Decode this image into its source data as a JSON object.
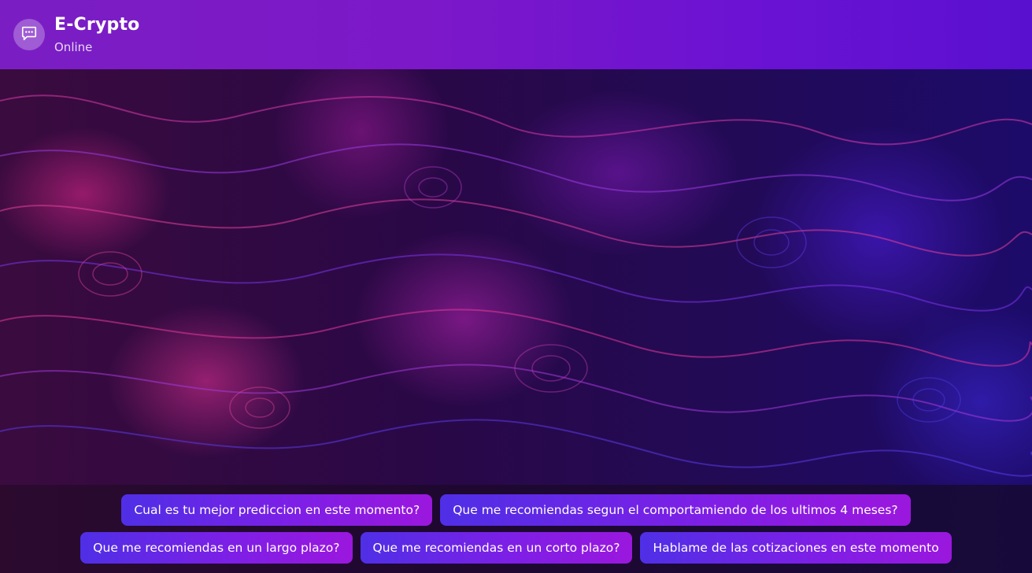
{
  "header": {
    "avatar_icon": "chat-bubble-icon",
    "title": "E-Crypto",
    "status": "Online"
  },
  "chat": {
    "background": "abstract-purple-pink-swirl-wallpaper"
  },
  "suggestions": {
    "row1": [
      "Cual es tu mejor prediccion en este momento?",
      "Que me recomiendas segun el comportamiendo de los ultimos 4 meses?"
    ],
    "row2": [
      "Que me recomiendas en un largo plazo?",
      "Que me recomiendas en un corto plazo?",
      "Hablame de las cotizaciones en este momento"
    ]
  },
  "colors": {
    "header": "#7a1ec4",
    "chip_start": "#4f2fe6",
    "chip_end": "#9b17de"
  }
}
